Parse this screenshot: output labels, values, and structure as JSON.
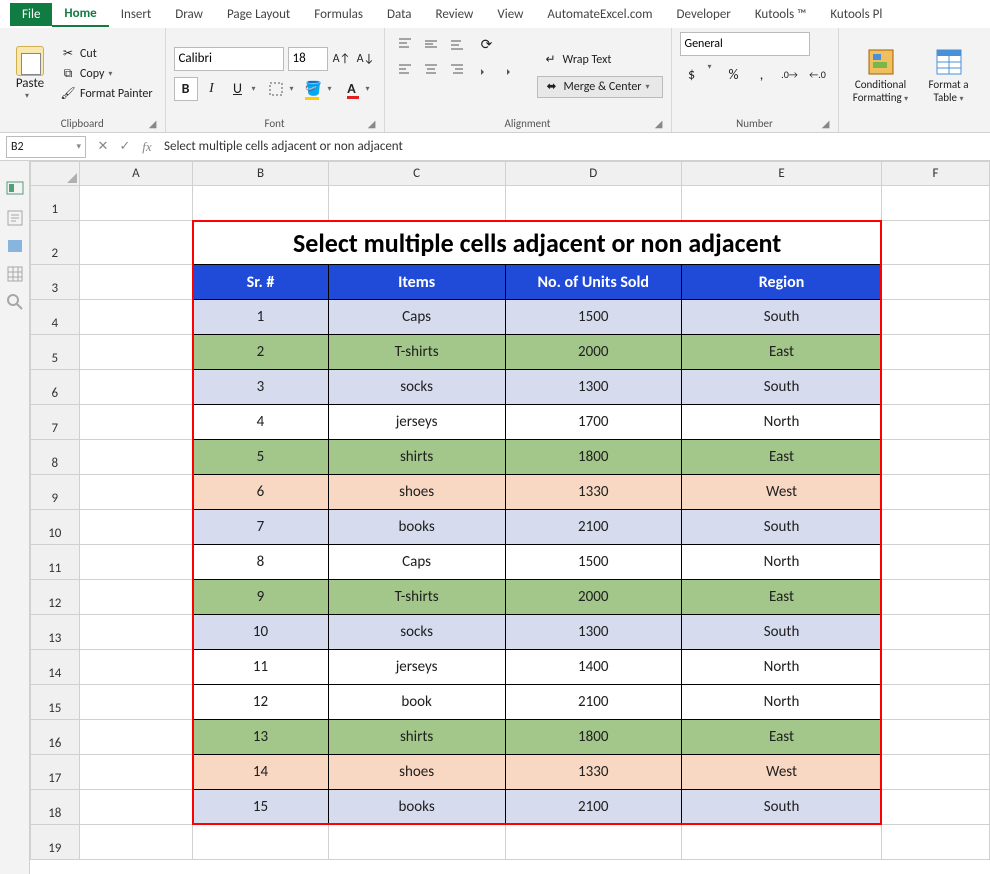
{
  "tabs": {
    "file": "File",
    "home": "Home",
    "insert": "Insert",
    "draw": "Draw",
    "page_layout": "Page Layout",
    "formulas": "Formulas",
    "data": "Data",
    "review": "Review",
    "view": "View",
    "automateexcel": "AutomateExcel.com",
    "developer": "Developer",
    "kutools": "Kutools ™",
    "kutools_plus": "Kutools Pl"
  },
  "ribbon": {
    "clipboard": {
      "paste": "Paste",
      "cut": "Cut",
      "copy": "Copy",
      "format_painter": "Format Painter",
      "label": "Clipboard"
    },
    "font": {
      "name": "Calibri",
      "size": "18",
      "bold": "B",
      "italic": "I",
      "underline": "U",
      "label": "Font"
    },
    "alignment": {
      "wrap": "Wrap Text",
      "merge": "Merge & Center",
      "label": "Alignment"
    },
    "number": {
      "format": "General",
      "label": "Number"
    },
    "styles": {
      "conditional": "Conditional Formatting",
      "table": "Format as Table",
      "cond1": "Conditional",
      "cond2": "Formatting",
      "tbl1": "Format a",
      "tbl2": "Table"
    }
  },
  "formula_bar": {
    "name_box": "B2",
    "formula": "Select multiple cells adjacent or non adjacent"
  },
  "columns": [
    "A",
    "B",
    "C",
    "D",
    "E",
    "F"
  ],
  "sheet": {
    "title": "Select multiple cells adjacent or non adjacent",
    "headers": {
      "sr": "Sr. #",
      "items": "Items",
      "units": "No. of Units Sold",
      "region": "Region"
    },
    "rows": [
      {
        "sr": "1",
        "item": "Caps",
        "units": "1500",
        "region": "South",
        "color": "blue"
      },
      {
        "sr": "2",
        "item": "T-shirts",
        "units": "2000",
        "region": "East",
        "color": "green"
      },
      {
        "sr": "3",
        "item": "socks",
        "units": "1300",
        "region": "South",
        "color": "blue"
      },
      {
        "sr": "4",
        "item": "jerseys",
        "units": "1700",
        "region": "North",
        "color": "white"
      },
      {
        "sr": "5",
        "item": "shirts",
        "units": "1800",
        "region": "East",
        "color": "green"
      },
      {
        "sr": "6",
        "item": "shoes",
        "units": "1330",
        "region": "West",
        "color": "peach"
      },
      {
        "sr": "7",
        "item": "books",
        "units": "2100",
        "region": "South",
        "color": "blue"
      },
      {
        "sr": "8",
        "item": "Caps",
        "units": "1500",
        "region": "North",
        "color": "white"
      },
      {
        "sr": "9",
        "item": "T-shirts",
        "units": "2000",
        "region": "East",
        "color": "green"
      },
      {
        "sr": "10",
        "item": "socks",
        "units": "1300",
        "region": "South",
        "color": "blue"
      },
      {
        "sr": "11",
        "item": "jerseys",
        "units": "1400",
        "region": "North",
        "color": "white"
      },
      {
        "sr": "12",
        "item": "book",
        "units": "2100",
        "region": "North",
        "color": "white"
      },
      {
        "sr": "13",
        "item": "shirts",
        "units": "1800",
        "region": "East",
        "color": "green"
      },
      {
        "sr": "14",
        "item": "shoes",
        "units": "1330",
        "region": "West",
        "color": "peach"
      },
      {
        "sr": "15",
        "item": "books",
        "units": "2100",
        "region": "South",
        "color": "blue"
      }
    ],
    "row_numbers": [
      "1",
      "2",
      "3",
      "4",
      "5",
      "6",
      "7",
      "8",
      "9",
      "10",
      "11",
      "12",
      "13",
      "14",
      "15",
      "16",
      "17",
      "18",
      "19"
    ]
  }
}
